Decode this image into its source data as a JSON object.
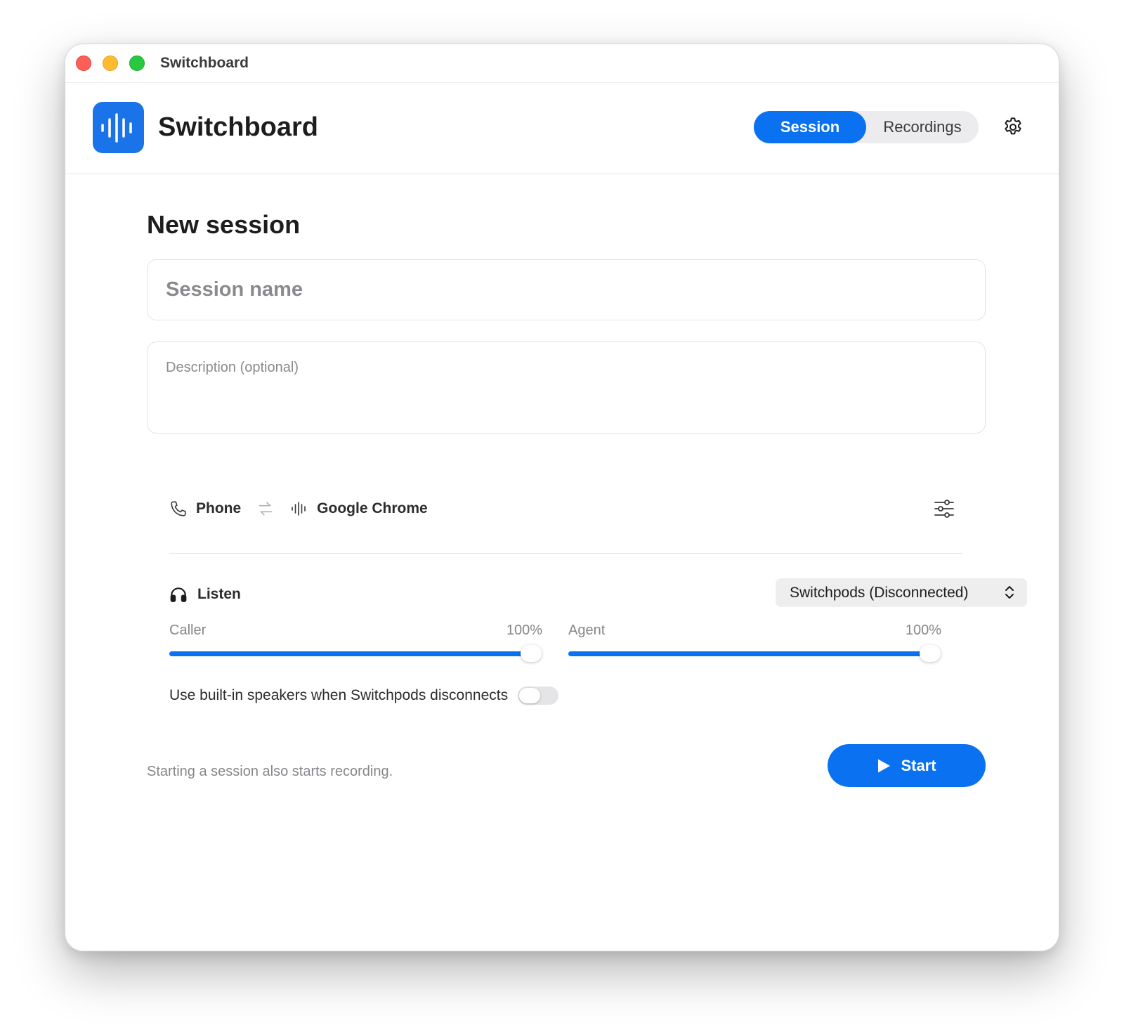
{
  "window": {
    "title": "Switchboard"
  },
  "header": {
    "app_name": "Switchboard",
    "logo_icon": "waveform-icon",
    "tabs": [
      {
        "label": "Session",
        "active": true
      },
      {
        "label": "Recordings",
        "active": false
      }
    ],
    "settings_icon": "gear-icon"
  },
  "form": {
    "title": "New session",
    "session_name": {
      "placeholder": "Session name",
      "value": ""
    },
    "description": {
      "placeholder": "Description (optional)",
      "value": ""
    }
  },
  "route": {
    "source_label": "Phone",
    "source_icon": "phone-icon",
    "swap_icon": "swap-arrows-icon",
    "target_label": "Google Chrome",
    "target_icon": "waveform-icon",
    "options_icon": "sliders-icon"
  },
  "listen": {
    "label": "Listen",
    "icon": "headphones-icon",
    "device": "Switchpods (Disconnected)",
    "caller": {
      "label": "Caller",
      "value_text": "100%",
      "level": 1.0
    },
    "agent": {
      "label": "Agent",
      "value_text": "100%",
      "level": 1.0
    },
    "fallback_toggle": {
      "label": "Use built-in speakers when Switchpods disconnects",
      "on": false
    }
  },
  "footer": {
    "note": "Starting a session also starts recording.",
    "start_label": "Start",
    "start_icon": "play-icon"
  },
  "colors": {
    "accent": "#0a72f0",
    "logo_bg": "#1a73e8",
    "muted_text": "#86868b"
  }
}
